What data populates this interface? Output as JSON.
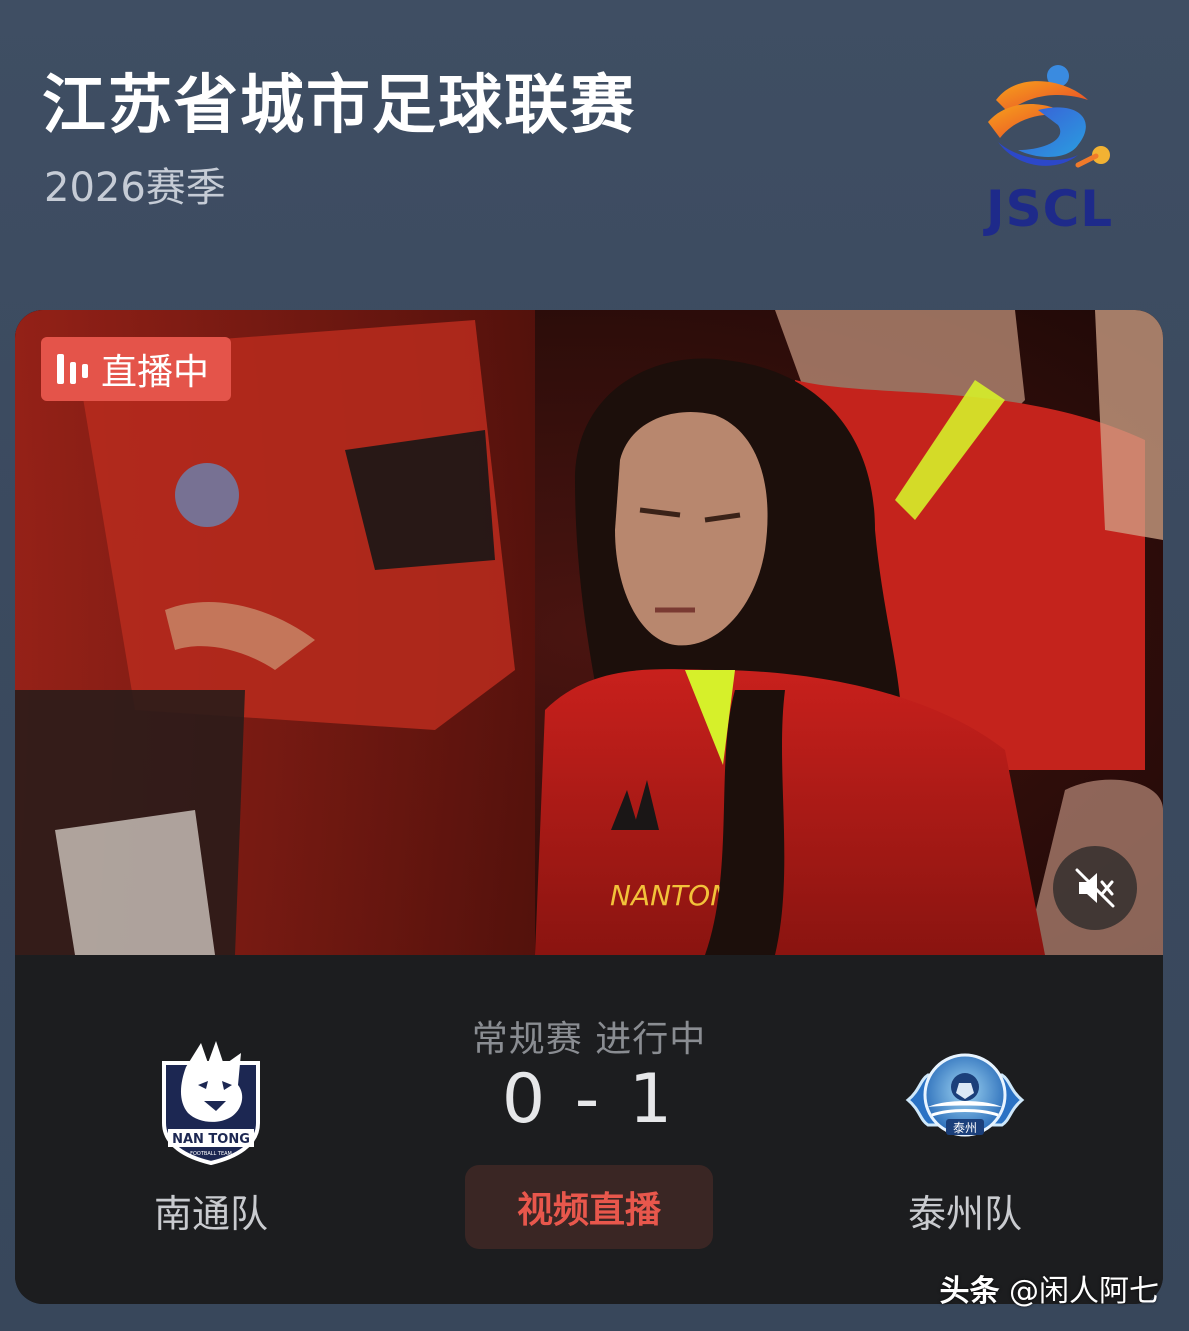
{
  "header": {
    "title": "江苏省城市足球联赛",
    "subtitle": "2026赛季",
    "logo_text": "JSCL"
  },
  "video": {
    "live_label": "直播中",
    "jersey_text": "NANTON",
    "mute_icon": "volume-mute-icon"
  },
  "match": {
    "status": "常规赛 进行中",
    "score": "0 - 1",
    "home_score": 0,
    "away_score": 1,
    "watch_button": "视频直播",
    "home_team": {
      "name": "南通队",
      "logo_text": "NAN TONG",
      "logo_subtext": "FOOTBALL TEAM"
    },
    "away_team": {
      "name": "泰州队",
      "logo_text": "泰州"
    }
  },
  "watermark": {
    "brand": "头条",
    "author": "@闲人阿七"
  },
  "colors": {
    "background": "#3b4a5f",
    "live_red": "#e4544a",
    "panel": "#1c1d1f",
    "watch_button_text": "#e8574c",
    "logo_blue": "#1e2a8a"
  }
}
